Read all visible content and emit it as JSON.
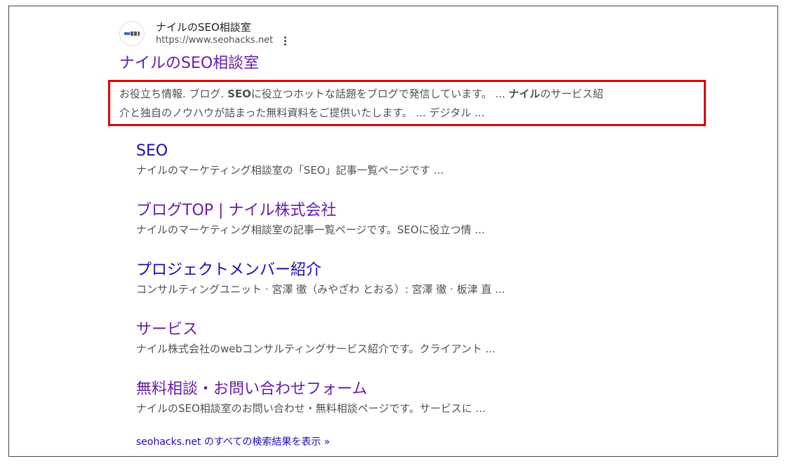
{
  "result": {
    "site_name": "ナイルのSEO相談室",
    "site_url": "https://www.seohacks.net",
    "title": "ナイルのSEO相談室",
    "snippet": {
      "p1": "お役立ち情報. ブログ. ",
      "b1": "SEO",
      "p2": "に役立つホットな話題をブログで発信しています。 ... ",
      "b2": "ナイル",
      "p3": "のサービス紹",
      "line2": "介と独自のノウハウが詰まった無料資料をご提供いたします。 ... デジタル ..."
    }
  },
  "sitelinks": [
    {
      "title": "SEO",
      "desc": "ナイルのマーケティング相談室の「SEO」記事一覧ページです ..."
    },
    {
      "title": "ブログTOP | ナイル株式会社",
      "desc": "ナイルのマーケティング相談室の記事一覧ページです。SEOに役立つ情 ..."
    },
    {
      "title": "プロジェクトメンバー紹介",
      "desc": "コンサルティングユニット · 宮澤 徹（みやざわ とおる）: 宮澤 徹 · 板津 直 ..."
    },
    {
      "title": "サービス",
      "desc": "ナイル株式会社のwebコンサルティングサービス紹介です。クライアント ..."
    },
    {
      "title": "無料相談・お問い合わせフォーム",
      "desc": "ナイルのSEO相談室のお問い合わせ・無料相談ページです。サービスに ..."
    }
  ],
  "all_results_link": "seohacks.net のすべての検索結果を表示 »",
  "colors": {
    "visited_link": "#681da8",
    "unvisited_link": "#1a0dab",
    "highlight_border": "#e00000"
  }
}
